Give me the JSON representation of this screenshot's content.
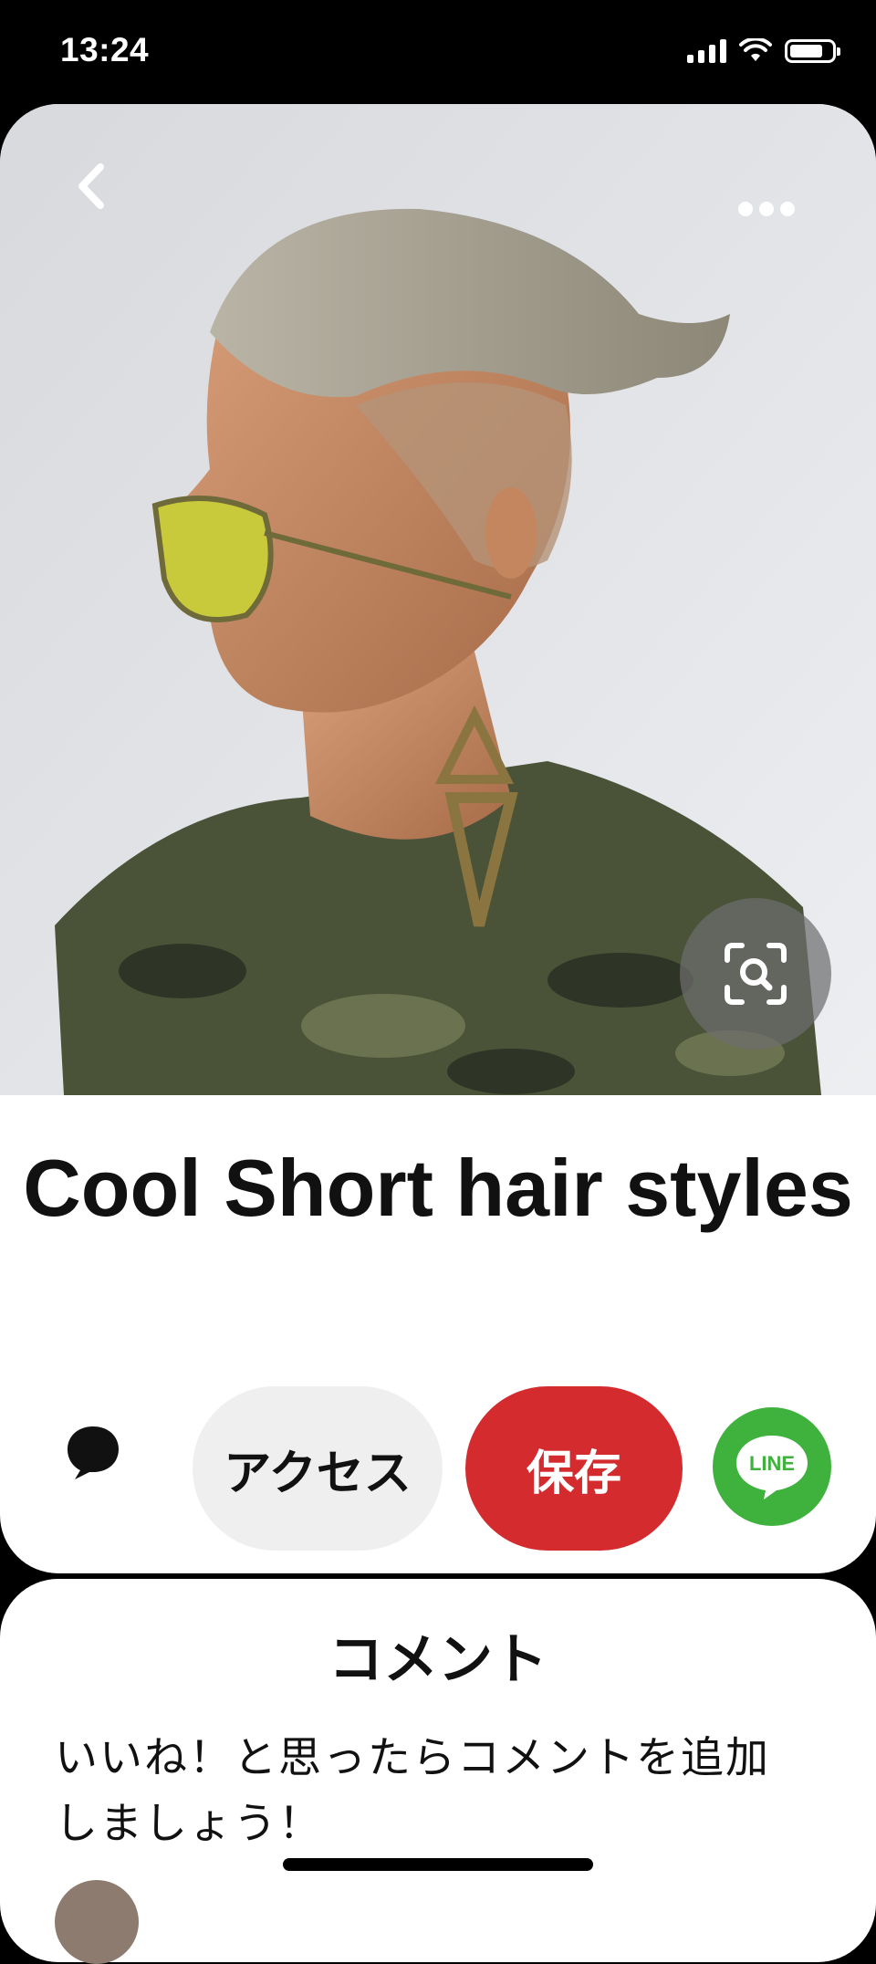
{
  "status_bar": {
    "time": "13:24",
    "icons": [
      "cellular-signal-icon",
      "wifi-icon",
      "battery-icon"
    ]
  },
  "pin": {
    "image_icon": "photo",
    "back_icon": "chevron-left-icon",
    "more_icon": "more-horizontal-icon",
    "visual_search_icon": "visual-search-icon",
    "title": "Cool Short hair styles"
  },
  "actions": {
    "comment_icon": "comment-bubble-icon",
    "access_label": "アクセス",
    "save_label": "保存",
    "line_label": "LINE"
  },
  "comments": {
    "title": "コメント",
    "prompt": "いいね！と思ったらコメントを追加しましょう！"
  },
  "colors": {
    "save": "#d42b2f",
    "access_bg": "#efefef",
    "line": "#3fb23d",
    "background": "#000000"
  }
}
